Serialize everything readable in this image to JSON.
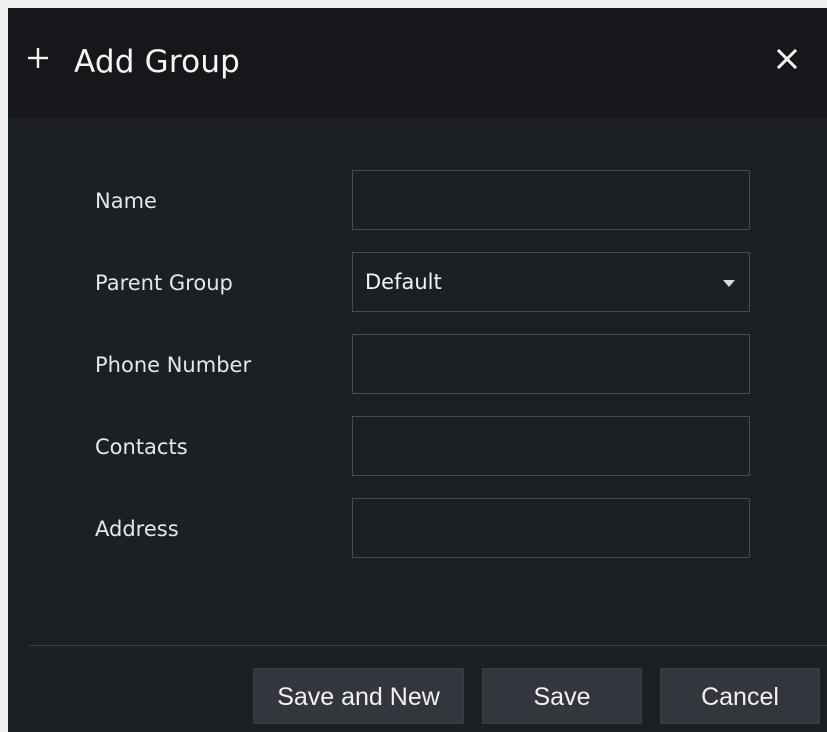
{
  "dialog": {
    "title": "Add Group",
    "title_icon": "plus-icon",
    "close_icon": "close-icon"
  },
  "form": {
    "fields": [
      {
        "label": "Name",
        "type": "text",
        "value": ""
      },
      {
        "label": "Parent Group",
        "type": "select",
        "value": "Default",
        "icon": "chevron-down-icon"
      },
      {
        "label": "Phone Number",
        "type": "text",
        "value": ""
      },
      {
        "label": "Contacts",
        "type": "text",
        "value": ""
      },
      {
        "label": "Address",
        "type": "text",
        "value": ""
      }
    ]
  },
  "footer": {
    "save_and_new_label": "Save and New",
    "save_label": "Save",
    "cancel_label": "Cancel"
  },
  "colors": {
    "dialog_background": "#1c1f24",
    "header_background": "#15171b",
    "field_border": "#474b52",
    "button_background": "#33373d",
    "text": "#e4e7ed"
  }
}
